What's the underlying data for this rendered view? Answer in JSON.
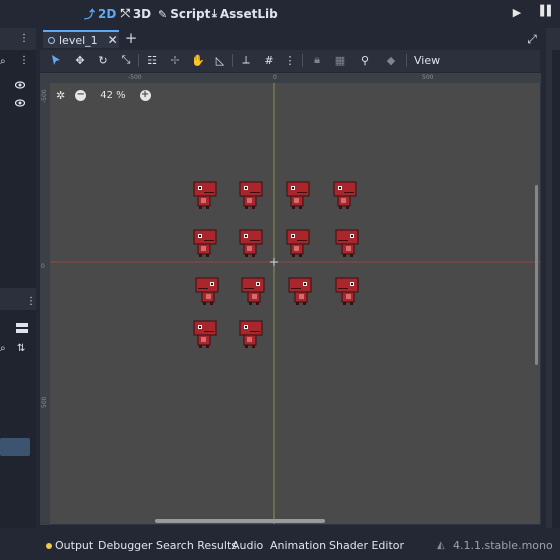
{
  "workspace_tabs": [
    {
      "label": "2D",
      "icon": "⅟"
    },
    {
      "label": "3D",
      "icon": "⅋"
    },
    {
      "label": "Script",
      "icon": "✎"
    },
    {
      "label": "AssetLib",
      "icon": "⤓"
    }
  ],
  "scene": {
    "tab_label": "level_1"
  },
  "toolbar": {
    "view_label": "View"
  },
  "viewport": {
    "zoom_label": "42 %",
    "zoom_minus": "−",
    "zoom_plus": "+",
    "ruler_top_labels": [
      "-500",
      "0",
      "500"
    ],
    "ruler_left_labels": [
      "-500",
      "0",
      "500"
    ],
    "sprite_color": "#a8262c",
    "sprites": [
      {
        "row": 0,
        "col": 0,
        "facing": "right"
      },
      {
        "row": 0,
        "col": 1,
        "facing": "right"
      },
      {
        "row": 0,
        "col": 2,
        "facing": "right"
      },
      {
        "row": 0,
        "col": 3,
        "facing": "right"
      },
      {
        "row": 1,
        "col": 0,
        "facing": "right"
      },
      {
        "row": 1,
        "col": 1,
        "facing": "right"
      },
      {
        "row": 1,
        "col": 2,
        "facing": "right"
      },
      {
        "row": 1,
        "col": 3,
        "facing": "left"
      },
      {
        "row": 2,
        "col": 0,
        "facing": "left"
      },
      {
        "row": 2,
        "col": 1,
        "facing": "left"
      },
      {
        "row": 2,
        "col": 2,
        "facing": "left"
      },
      {
        "row": 2,
        "col": 3,
        "facing": "left"
      },
      {
        "row": 3,
        "col": 0,
        "facing": "right"
      },
      {
        "row": 3,
        "col": 1,
        "facing": "right"
      }
    ]
  },
  "bottom_panel": {
    "tabs": [
      "Output",
      "Debugger",
      "Search Results",
      "Audio",
      "Animation",
      "Shader Editor"
    ],
    "version": "4.1.1.stable.mono"
  },
  "colors": {
    "accent": "#5fa8f5",
    "background": "#232834",
    "viewport": "#4a4a4a",
    "x_axis": "#b04545",
    "y_axis": "#a8b84e"
  }
}
